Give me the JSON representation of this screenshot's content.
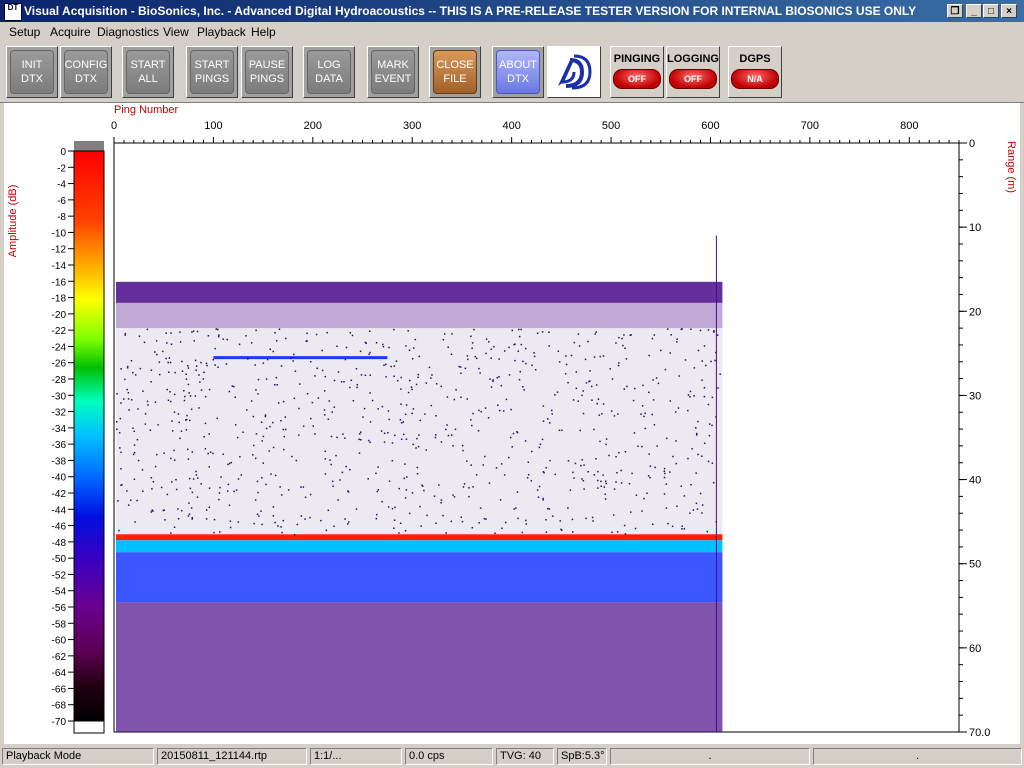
{
  "window": {
    "title": "Visual Acquisition  -  BioSonics, Inc.  -  Advanced Digital Hydroacoustics  -- THIS IS A PRE-RELEASE TESTER VERSION FOR INTERNAL BIOSONICS USE ONLY",
    "icon_label": "DT",
    "restore_glyph": "❐",
    "minimize_glyph": "_",
    "maximize_glyph": "□",
    "close_glyph": "×"
  },
  "menu": [
    "Setup",
    "Acquire",
    "Diagnostics",
    "View",
    "Playback",
    "Help"
  ],
  "toolbar": {
    "buttons": [
      {
        "label": "INIT\nDTX"
      },
      {
        "label": "CONFIG\nDTX"
      },
      {
        "label": "START\nALL"
      },
      {
        "label": "START\nPINGS"
      },
      {
        "label": "PAUSE\nPINGS"
      },
      {
        "label": "LOG\nDATA"
      },
      {
        "label": "MARK\nEVENT"
      },
      {
        "label": "CLOSE\nFILE"
      },
      {
        "label": "ABOUT\nDTX"
      }
    ],
    "logo_icon": "biosonics-logo-icon",
    "indicators": [
      {
        "label": "PINGING",
        "state": "OFF"
      },
      {
        "label": "LOGGING",
        "state": "OFF"
      },
      {
        "label": "DGPS",
        "state": "N/A"
      }
    ]
  },
  "echogram": {
    "x_axis_label": "Ping Number",
    "x_ticks": [
      "0",
      "100",
      "200",
      "300",
      "400",
      "500",
      "600",
      "700",
      "800"
    ],
    "y_axis_label": "Range (m)",
    "y_ticks": [
      "0",
      "10",
      "20",
      "30",
      "40",
      "50",
      "60",
      "70.0"
    ],
    "colorbar_label": "Amplitude (dB)",
    "colorbar_ticks": [
      "0",
      "-2",
      "-4",
      "-6",
      "-8",
      "-10",
      "-12",
      "-14",
      "-16",
      "-18",
      "-20",
      "-22",
      "-24",
      "-26",
      "-28",
      "-30",
      "-32",
      "-34",
      "-36",
      "-38",
      "-40",
      "-42",
      "-44",
      "-46",
      "-48",
      "-50",
      "-52",
      "-54",
      "-56",
      "-58",
      "-60",
      "-62",
      "-64",
      "-66",
      "-68",
      "-70"
    ],
    "ping_max": 850,
    "range_max": 70,
    "data_extent_pings": 612,
    "surface_layer_range": [
      16.5,
      19.0
    ],
    "fish_trace": {
      "ping_start": 100,
      "ping_end": 275,
      "range": 25.5
    },
    "bottom_range": 46.5,
    "colors": {
      "bottom_red": "#ff2000",
      "layer_purple": "#4a0a8a",
      "deep_blue": "#1a3aff",
      "cyan": "#00c0ff"
    }
  },
  "status": {
    "mode": "Playback Mode",
    "file": "20150811_121144.rtp",
    "ratio": "1:1/...",
    "cps": "0.0 cps",
    "tvg": "TVG: 40",
    "spb": "SpB:5.3°",
    "extra1": ".",
    "extra2": "."
  }
}
